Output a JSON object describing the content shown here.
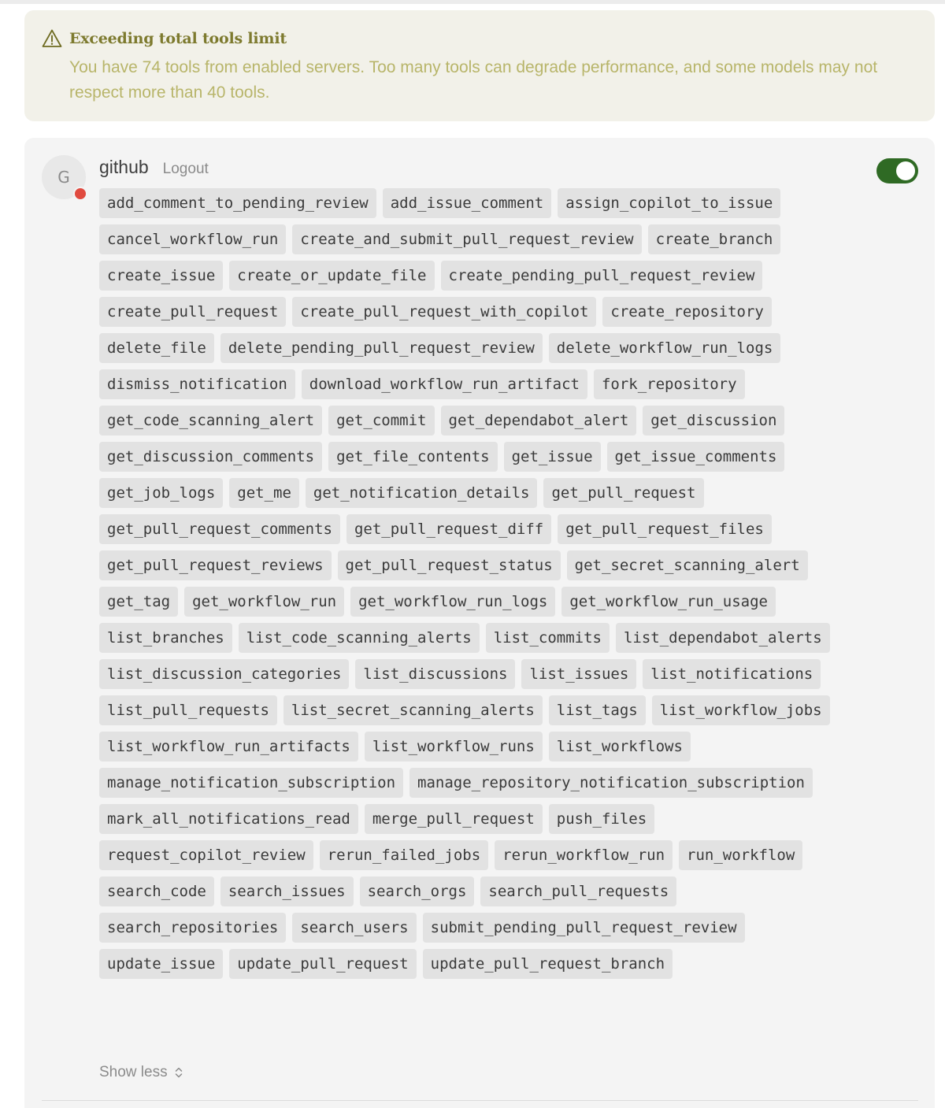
{
  "warning": {
    "icon": "warning-triangle-icon",
    "title": "Exceeding total tools limit",
    "message": "You have 74 tools from enabled servers. Too many tools can degrade performance, and some models may not respect more than 40 tools.",
    "colors": {
      "title": "#7d7a2e",
      "text": "#b8b56a",
      "background": "#f2f1e9"
    }
  },
  "server": {
    "avatar_letter": "G",
    "status": "error",
    "status_color": "#e04a3f",
    "name": "github",
    "logout_label": "Logout",
    "enabled": true,
    "toggle_color": "#2f6a24",
    "tools": [
      "add_comment_to_pending_review",
      "add_issue_comment",
      "assign_copilot_to_issue",
      "cancel_workflow_run",
      "create_and_submit_pull_request_review",
      "create_branch",
      "create_issue",
      "create_or_update_file",
      "create_pending_pull_request_review",
      "create_pull_request",
      "create_pull_request_with_copilot",
      "create_repository",
      "delete_file",
      "delete_pending_pull_request_review",
      "delete_workflow_run_logs",
      "dismiss_notification",
      "download_workflow_run_artifact",
      "fork_repository",
      "get_code_scanning_alert",
      "get_commit",
      "get_dependabot_alert",
      "get_discussion",
      "get_discussion_comments",
      "get_file_contents",
      "get_issue",
      "get_issue_comments",
      "get_job_logs",
      "get_me",
      "get_notification_details",
      "get_pull_request",
      "get_pull_request_comments",
      "get_pull_request_diff",
      "get_pull_request_files",
      "get_pull_request_reviews",
      "get_pull_request_status",
      "get_secret_scanning_alert",
      "get_tag",
      "get_workflow_run",
      "get_workflow_run_logs",
      "get_workflow_run_usage",
      "list_branches",
      "list_code_scanning_alerts",
      "list_commits",
      "list_dependabot_alerts",
      "list_discussion_categories",
      "list_discussions",
      "list_issues",
      "list_notifications",
      "list_pull_requests",
      "list_secret_scanning_alerts",
      "list_tags",
      "list_workflow_jobs",
      "list_workflow_run_artifacts",
      "list_workflow_runs",
      "list_workflows",
      "manage_notification_subscription",
      "manage_repository_notification_subscription",
      "mark_all_notifications_read",
      "merge_pull_request",
      "push_files",
      "request_copilot_review",
      "rerun_failed_jobs",
      "rerun_workflow_run",
      "run_workflow",
      "search_code",
      "search_issues",
      "search_orgs",
      "search_pull_requests",
      "search_repositories",
      "search_users",
      "submit_pending_pull_request_review",
      "update_issue",
      "update_pull_request",
      "update_pull_request_branch"
    ],
    "show_less_label": "Show less",
    "show_less_icon": "chevron-up-down-icon"
  }
}
